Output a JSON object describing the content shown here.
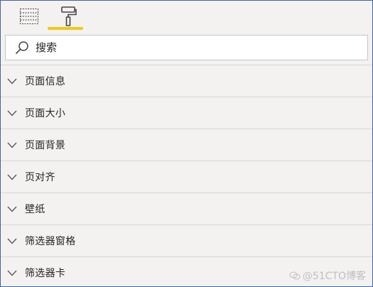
{
  "toolbar": {
    "tools": [
      {
        "icon": "fields-table-icon",
        "selected": false
      },
      {
        "icon": "paint-roller-icon",
        "selected": true
      }
    ],
    "accent": "#f2c811"
  },
  "search": {
    "placeholder": "搜索",
    "value": ""
  },
  "sections": [
    {
      "label": "页面信息",
      "expanded": false
    },
    {
      "label": "页面大小",
      "expanded": false
    },
    {
      "label": "页面背景",
      "expanded": false
    },
    {
      "label": "页对齐",
      "expanded": false
    },
    {
      "label": "壁纸",
      "expanded": false
    },
    {
      "label": "筛选器窗格",
      "expanded": false
    },
    {
      "label": "筛选器卡",
      "expanded": false
    }
  ],
  "watermark": {
    "text": "@51CTO博客"
  },
  "colors": {
    "panel_bg": "#f3f2f1",
    "border": "#3a64a8",
    "divider": "#d8d6d4",
    "text": "#252423"
  }
}
